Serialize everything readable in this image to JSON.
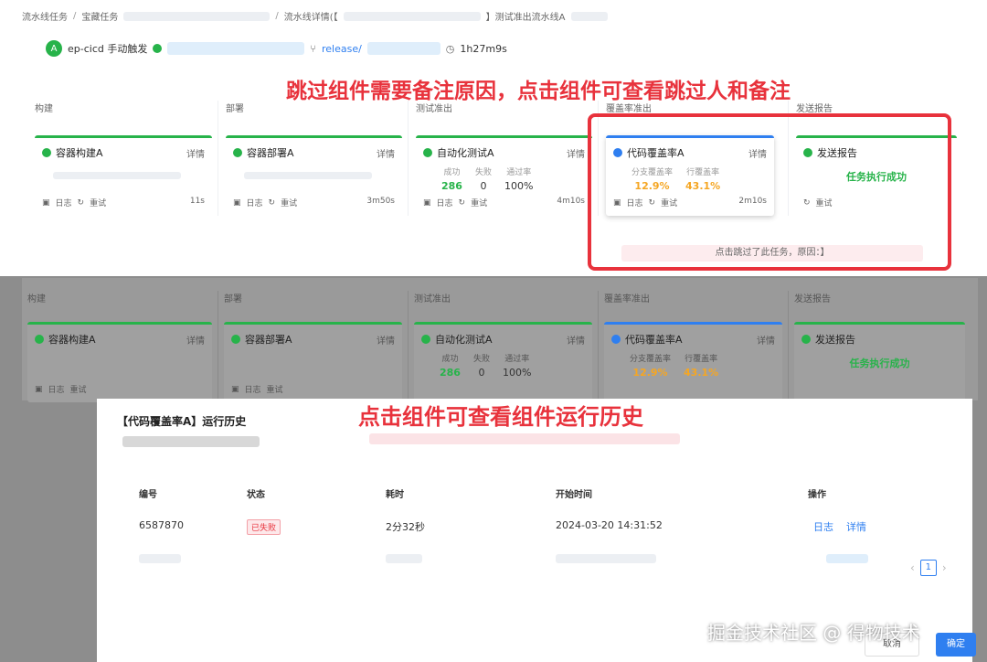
{
  "breadcrumb": {
    "items": [
      "流水线任务",
      "宝藏任务",
      "流水线详情(【",
      "】测试准出流水线A"
    ]
  },
  "run": {
    "avatar_letter": "A",
    "trigger": "ep-cicd 手动触发",
    "branch": "release/",
    "duration": "1h27m9s"
  },
  "annotations": {
    "skip_note_hint": "跳过组件需要备注原因，点击组件可查看跳过人和备注",
    "history_hint": "点击组件可查看组件运行历史"
  },
  "stages": [
    {
      "title": "构建",
      "card": "容器构建A",
      "detail": "详情",
      "log": "日志",
      "retry": "重试",
      "time": "11s"
    },
    {
      "title": "部署",
      "card": "容器部署A",
      "detail": "详情",
      "log": "日志",
      "retry": "重试",
      "time": "3m50s"
    },
    {
      "title": "测试准出",
      "card": "自动化测试A",
      "detail": "详情",
      "log": "日志",
      "retry": "重试",
      "time": "4m10s",
      "metrics": [
        {
          "label": "成功",
          "value": "286"
        },
        {
          "label": "失败",
          "value": "0"
        },
        {
          "label": "通过率",
          "value": "100%"
        }
      ]
    },
    {
      "title": "覆盖率准出",
      "card": "代码覆盖率A",
      "detail": "详情",
      "log": "日志",
      "retry": "重试",
      "time": "2m10s",
      "metrics": [
        {
          "label": "分支覆盖率",
          "value": "12.9%"
        },
        {
          "label": "行覆盖率",
          "value": "43.1%"
        }
      ],
      "skip_note": "点击跳过了此任务，原因：】"
    },
    {
      "title": "发送报告",
      "card": "发送报告",
      "status_text": "任务执行成功",
      "retry": "重试"
    }
  ],
  "modal": {
    "title": "【代码覆盖率A】运行历史",
    "columns": [
      "编号",
      "状态",
      "耗时",
      "开始时间",
      "操作"
    ],
    "rows": [
      {
        "id": "6587870",
        "status": "已失败",
        "duration": "2分32秒",
        "start": "2024-03-20 14:31:52",
        "actions": [
          "日志",
          "详情"
        ]
      }
    ],
    "page": "1",
    "cancel": "取消",
    "ok": "确定"
  },
  "watermark": "掘金技术社区 @ 得物技术",
  "colors": {
    "success": "#27b34a",
    "primary": "#2f7ff0",
    "warning": "#f5a623",
    "danger": "#e8323c"
  }
}
